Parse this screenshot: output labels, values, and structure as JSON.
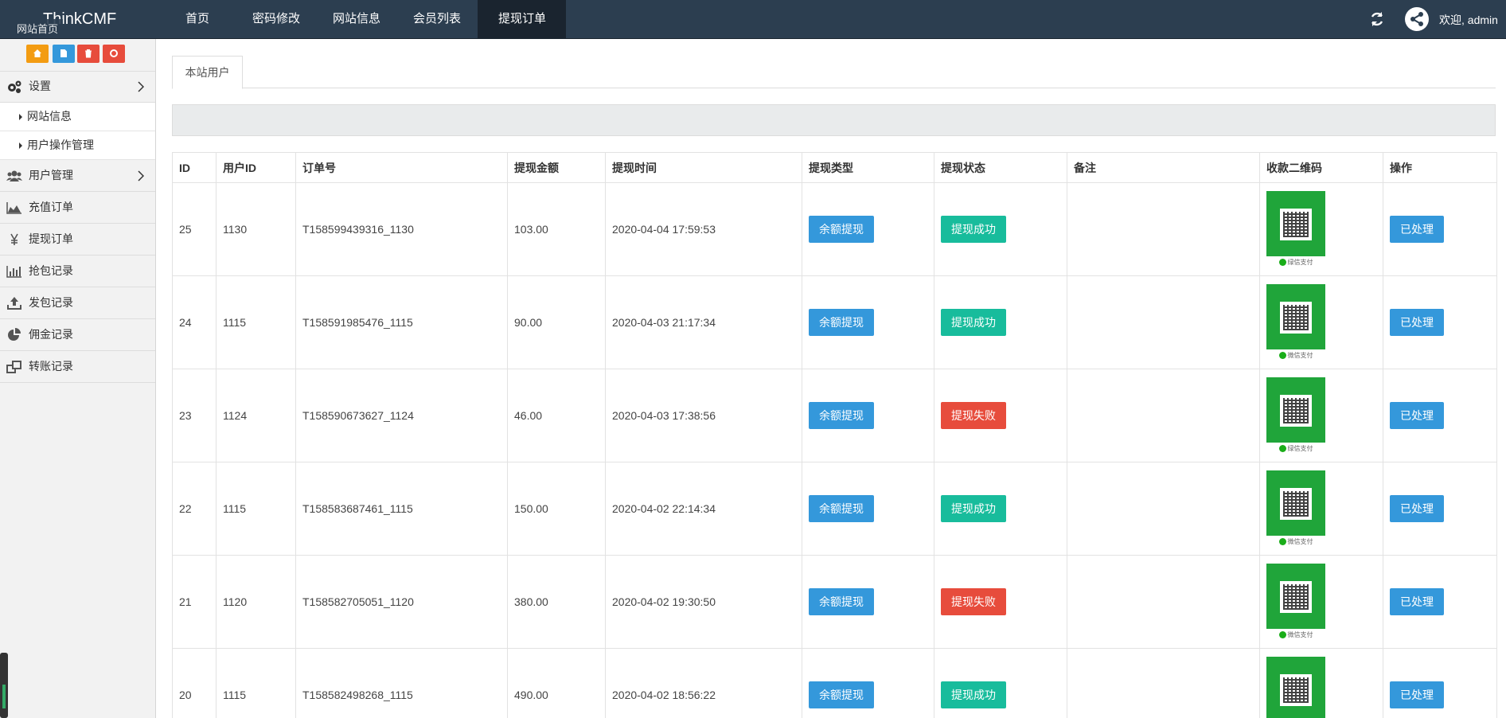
{
  "app": {
    "brand": "ThinkCMF"
  },
  "topnav": {
    "items": [
      "首页",
      "密码修改",
      "网站信息",
      "会员列表",
      "提现订单"
    ],
    "active_index": 4,
    "welcome": "欢迎, admin"
  },
  "sidebar": {
    "tooltip": "网站首页",
    "shortcut_colors": [
      "#f39c12",
      "#3498db",
      "#e74c3c",
      "#e74c3c"
    ],
    "settings_label": "设置",
    "sub_items": [
      "网站信息",
      "用户操作管理"
    ],
    "items": [
      "用户管理",
      "充值订单",
      "提现订单",
      "抢包记录",
      "发包记录",
      "佣金记录",
      "转账记录"
    ]
  },
  "tabs": {
    "active": "本站用户"
  },
  "table": {
    "headers": [
      "ID",
      "用户ID",
      "订单号",
      "提现金额",
      "提现时间",
      "提现类型",
      "提现状态",
      "备注",
      "收款二维码",
      "操作"
    ],
    "rows": [
      {
        "id": "25",
        "user_id": "1130",
        "order_no": "T158599439316_1130",
        "amount": "103.00",
        "time": "2020-04-04 17:59:53",
        "type": "余额提现",
        "status": "提现成功",
        "status_kind": "success",
        "remark": "",
        "qr_label": "绿信支付",
        "action": "已处理"
      },
      {
        "id": "24",
        "user_id": "1115",
        "order_no": "T158591985476_1115",
        "amount": "90.00",
        "time": "2020-04-03 21:17:34",
        "type": "余额提现",
        "status": "提现成功",
        "status_kind": "success",
        "remark": "",
        "qr_label": "微信支付",
        "action": "已处理"
      },
      {
        "id": "23",
        "user_id": "1124",
        "order_no": "T158590673627_1124",
        "amount": "46.00",
        "time": "2020-04-03 17:38:56",
        "type": "余额提现",
        "status": "提现失败",
        "status_kind": "fail",
        "remark": "",
        "qr_label": "绿信支付",
        "action": "已处理"
      },
      {
        "id": "22",
        "user_id": "1115",
        "order_no": "T158583687461_1115",
        "amount": "150.00",
        "time": "2020-04-02 22:14:34",
        "type": "余额提现",
        "status": "提现成功",
        "status_kind": "success",
        "remark": "",
        "qr_label": "微信支付",
        "action": "已处理"
      },
      {
        "id": "21",
        "user_id": "1120",
        "order_no": "T158582705051_1120",
        "amount": "380.00",
        "time": "2020-04-02 19:30:50",
        "type": "余额提现",
        "status": "提现失败",
        "status_kind": "fail",
        "remark": "",
        "qr_label": "微信支付",
        "action": "已处理"
      },
      {
        "id": "20",
        "user_id": "1115",
        "order_no": "T158582498268_1115",
        "amount": "490.00",
        "time": "2020-04-02 18:56:22",
        "type": "余额提现",
        "status": "提现成功",
        "status_kind": "success",
        "remark": "",
        "qr_label": "",
        "action": "已处理"
      }
    ]
  }
}
